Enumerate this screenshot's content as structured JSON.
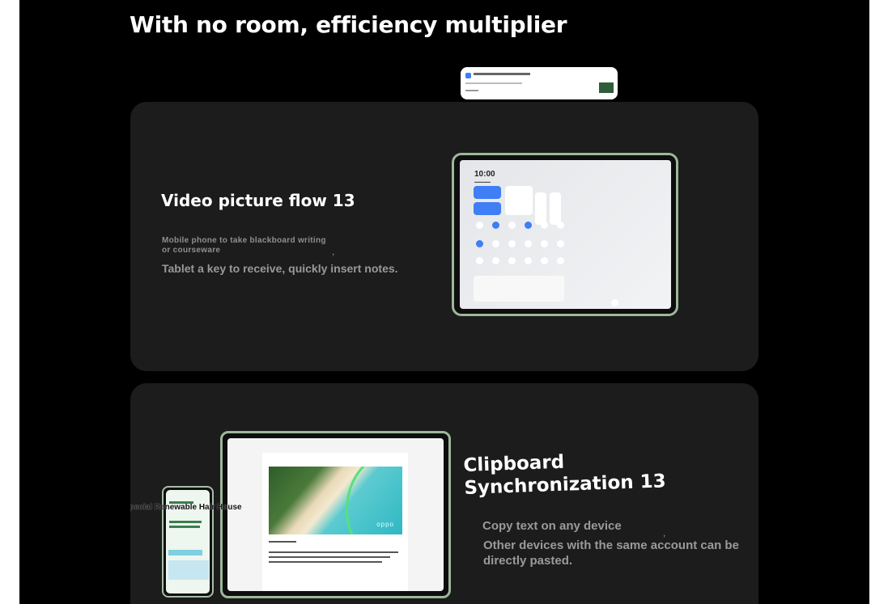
{
  "page": {
    "headline": "With no room, efficiency multiplier"
  },
  "card1": {
    "title": "Video picture flow 13",
    "small_text": "Mobile phone to take blackboard writing or courseware",
    "comma": ",",
    "big_text": "Tablet a key to receive, quickly insert notes.",
    "tablet_clock": "10:00"
  },
  "card2": {
    "title": "Clipboard Synchronization 13",
    "line1": "Copy text on any device",
    "comma": ",",
    "line2": "Other devices with the same account can be directly pasted.",
    "photo_logo": "oppo",
    "overlap_label": "Special Renewable Hair House"
  },
  "colors": {
    "page_bg": "#000000",
    "card_bg": "#1c1c1c",
    "device_frame": "#9db79a",
    "accent_blue": "#3f7ef4"
  }
}
